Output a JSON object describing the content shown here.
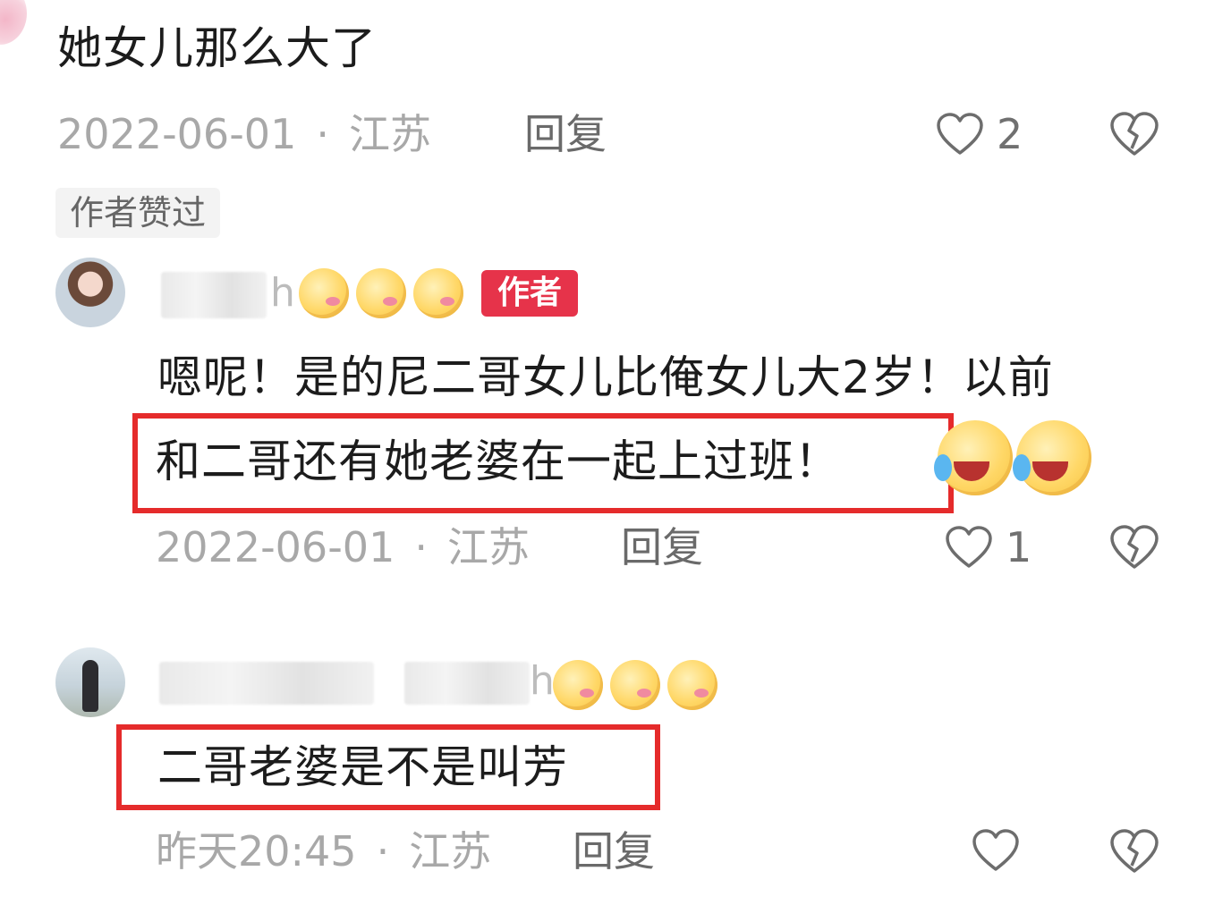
{
  "comment1": {
    "text": "她女儿那么大了",
    "date": "2022-06-01",
    "location": "江苏",
    "reply_label": "回复",
    "like_count": "2",
    "author_liked_badge": "作者赞过"
  },
  "comment2": {
    "username_suffix": "h",
    "author_badge": "作者",
    "text_line1": "嗯呢！是的尼二哥女儿比俺女儿大2岁！以前",
    "text_line2": "和二哥还有她老婆在一起上过班！",
    "date": "2022-06-01",
    "location": "江苏",
    "reply_label": "回复",
    "like_count": "1"
  },
  "comment3": {
    "username_suffix": "h",
    "text": "二哥老婆是不是叫芳",
    "date": "昨天20:45",
    "location": "江苏",
    "reply_label": "回复",
    "like_count": ""
  },
  "meta_separator": "·",
  "colors": {
    "highlight_box": "#e52b2b",
    "author_badge": "#e6334a",
    "meta_text": "#a8a8a8"
  },
  "icons": [
    "heart-icon",
    "broken-heart-icon",
    "kiss-emoji-icon",
    "laugh-cry-emoji-icon"
  ]
}
